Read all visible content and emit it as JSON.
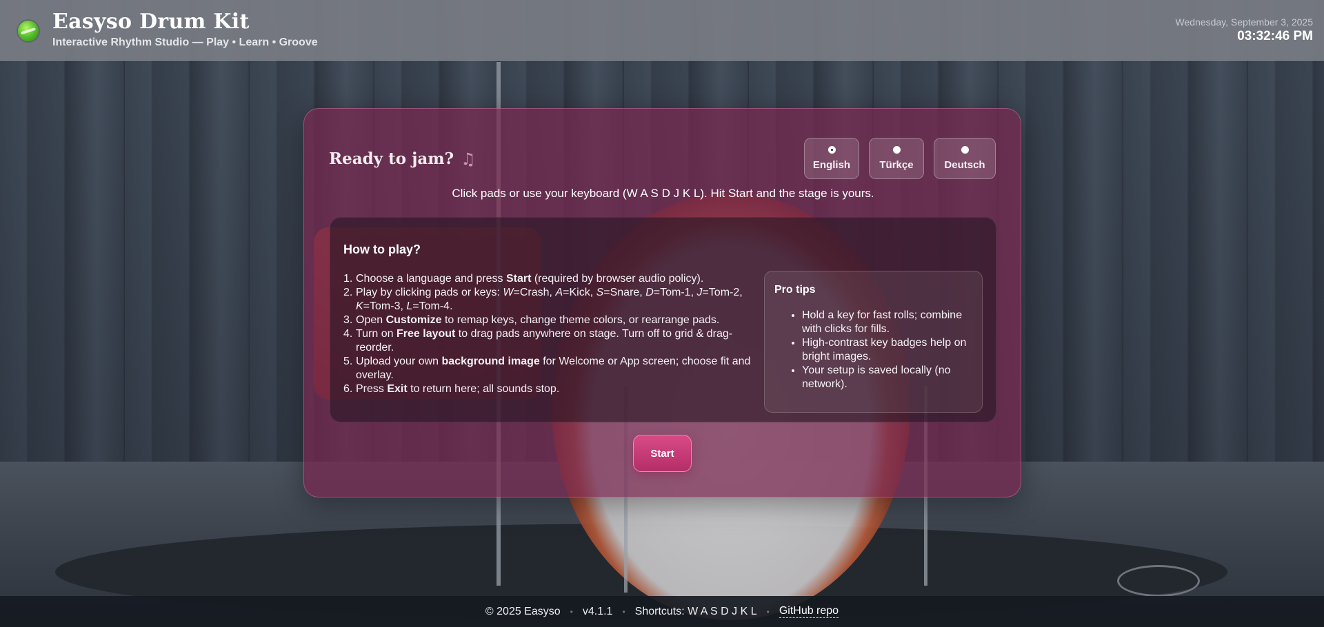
{
  "header": {
    "title": "Easyso Drum Kit",
    "subtitle": "Interactive Rhythm Studio — Play • Learn • Groove",
    "date": "Wednesday, September 3, 2025",
    "time": "03:32:46 PM",
    "logo_icon": "drum-logo-icon"
  },
  "welcome": {
    "title": "Ready to jam?",
    "title_icon": "music-note-icon",
    "intro": "Click pads or use your keyboard (W A S D J K L). Hit Start and the stage is yours.",
    "languages": [
      {
        "label": "English",
        "selected": true
      },
      {
        "label": "Türkçe",
        "selected": false
      },
      {
        "label": "Deutsch",
        "selected": false
      }
    ],
    "howto": {
      "title": "How to play?",
      "steps": [
        {
          "num": "1.",
          "parts": [
            "Choose a language and press ",
            "Start",
            " (required by browser audio policy)."
          ]
        },
        {
          "num": "2.",
          "parts": [
            "Play by clicking pads or keys: ",
            "W",
            "=Crash, ",
            "A",
            "=Kick, ",
            "S",
            "=Snare, ",
            "D",
            "=Tom-1, ",
            "J",
            "=Tom-2, ",
            "K",
            "=Tom-3, ",
            "L",
            "=Tom-4."
          ]
        },
        {
          "num": "3.",
          "parts": [
            "Open ",
            "Customize",
            " to remap keys, change theme colors, or rearrange pads."
          ]
        },
        {
          "num": "4.",
          "parts": [
            "Turn on ",
            "Free layout",
            " to drag pads anywhere on stage. Turn off to grid & drag-reorder."
          ]
        },
        {
          "num": "5.",
          "parts": [
            "Upload your own ",
            "background image",
            " for Welcome or App screen; choose fit and overlay."
          ]
        },
        {
          "num": "6.",
          "parts": [
            "Press ",
            "Exit",
            " to return here; all sounds stop."
          ]
        }
      ]
    },
    "tips": {
      "title": "Pro tips",
      "items": [
        "Hold a key for fast rolls; combine with clicks for fills.",
        "High-contrast key badges help on bright images.",
        "Your setup is saved locally (no network)."
      ]
    },
    "start_label": "Start"
  },
  "footer": {
    "copyright": "© 2025 Easyso",
    "version": "v4.1.1",
    "shortcuts": "Shortcuts: W A S D J K L",
    "repo_link": "GitHub repo",
    "separator": "•"
  },
  "colors": {
    "accent": "#c93a76",
    "card": "#782850",
    "header": "#787c83"
  }
}
